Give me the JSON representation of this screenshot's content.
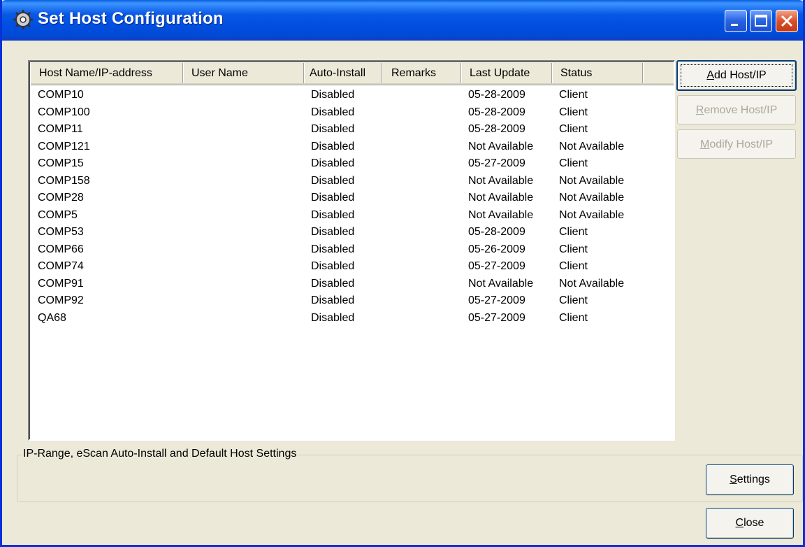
{
  "window": {
    "title": "Set Host Configuration",
    "title_icon": "gear-icon"
  },
  "titlebar_buttons": [
    "minimize",
    "maximize",
    "close"
  ],
  "table": {
    "columns": [
      "Host Name/IP-address",
      "User Name",
      "Auto-Install",
      "Remarks",
      "Last Update",
      "Status"
    ],
    "rows": [
      {
        "host": "COMP10",
        "user": "",
        "auto": "Disabled",
        "remarks": "",
        "update": "05-28-2009",
        "status": "Client"
      },
      {
        "host": "COMP100",
        "user": "",
        "auto": "Disabled",
        "remarks": "",
        "update": "05-28-2009",
        "status": "Client"
      },
      {
        "host": "COMP11",
        "user": "",
        "auto": "Disabled",
        "remarks": "",
        "update": "05-28-2009",
        "status": "Client"
      },
      {
        "host": "COMP121",
        "user": "",
        "auto": "Disabled",
        "remarks": "",
        "update": "Not Available",
        "status": "Not Available"
      },
      {
        "host": "COMP15",
        "user": "",
        "auto": "Disabled",
        "remarks": "",
        "update": "05-27-2009",
        "status": "Client"
      },
      {
        "host": "COMP158",
        "user": "",
        "auto": "Disabled",
        "remarks": "",
        "update": "Not Available",
        "status": "Not Available"
      },
      {
        "host": "COMP28",
        "user": "",
        "auto": "Disabled",
        "remarks": "",
        "update": "Not Available",
        "status": "Not Available"
      },
      {
        "host": "COMP5",
        "user": "",
        "auto": "Disabled",
        "remarks": "",
        "update": "Not Available",
        "status": "Not Available"
      },
      {
        "host": "COMP53",
        "user": "",
        "auto": "Disabled",
        "remarks": "",
        "update": "05-28-2009",
        "status": "Client"
      },
      {
        "host": "COMP66",
        "user": "",
        "auto": "Disabled",
        "remarks": "",
        "update": "05-26-2009",
        "status": "Client"
      },
      {
        "host": "COMP74",
        "user": "",
        "auto": "Disabled",
        "remarks": "",
        "update": "05-27-2009",
        "status": "Client"
      },
      {
        "host": "COMP91",
        "user": "",
        "auto": "Disabled",
        "remarks": "",
        "update": "Not Available",
        "status": "Not Available"
      },
      {
        "host": "COMP92",
        "user": "",
        "auto": "Disabled",
        "remarks": "",
        "update": "05-27-2009",
        "status": "Client"
      },
      {
        "host": "QA68",
        "user": "",
        "auto": "Disabled",
        "remarks": "",
        "update": "05-27-2009",
        "status": "Client"
      }
    ]
  },
  "buttons": {
    "add": {
      "mnemonic": "A",
      "rest": "dd Host/IP",
      "enabled": true
    },
    "remove": {
      "mnemonic": "R",
      "rest": "emove Host/IP",
      "enabled": false
    },
    "modify": {
      "mnemonic": "M",
      "rest": "odify Host/IP",
      "enabled": false
    },
    "settings": {
      "mnemonic": "S",
      "rest": "ettings",
      "enabled": true
    },
    "close": {
      "mnemonic": "C",
      "rest": "lose",
      "enabled": true
    }
  },
  "groupbox": {
    "label": "IP-Range, eScan Auto-Install and Default Host Settings"
  }
}
